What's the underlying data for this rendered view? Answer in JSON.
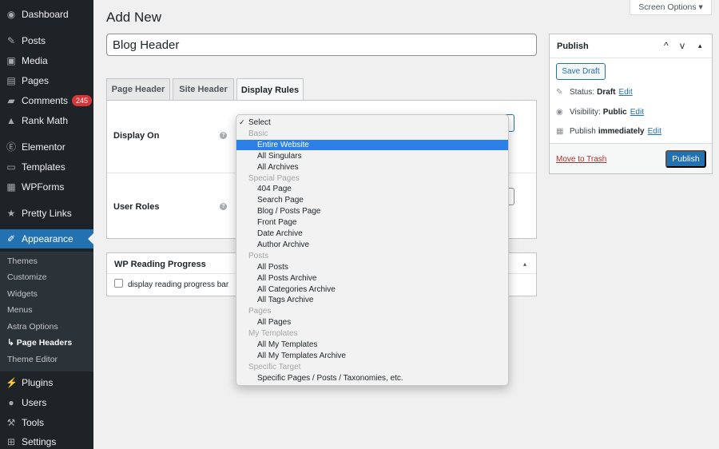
{
  "sidebar": {
    "items": [
      {
        "label": "Dashboard",
        "icon": "dashboard-icon",
        "glyph": "◉"
      },
      {
        "label": "Posts",
        "icon": "pin-icon",
        "glyph": "✎"
      },
      {
        "label": "Media",
        "icon": "media-icon",
        "glyph": "▣"
      },
      {
        "label": "Pages",
        "icon": "pages-icon",
        "glyph": "▤"
      },
      {
        "label": "Comments",
        "icon": "comments-icon",
        "glyph": "▰",
        "badge": "245"
      },
      {
        "label": "Rank Math",
        "icon": "rank-math-icon",
        "glyph": "▲"
      },
      {
        "label": "Elementor",
        "icon": "elementor-icon",
        "glyph": "Ⓔ"
      },
      {
        "label": "Templates",
        "icon": "folder-icon",
        "glyph": "▭"
      },
      {
        "label": "WPForms",
        "icon": "wpforms-icon",
        "glyph": "▦"
      },
      {
        "label": "Pretty Links",
        "icon": "star-icon",
        "glyph": "★"
      },
      {
        "label": "Appearance",
        "icon": "brush-icon",
        "glyph": "✐"
      },
      {
        "label": "Plugins",
        "icon": "plugin-icon",
        "glyph": "⚡"
      },
      {
        "label": "Users",
        "icon": "user-icon",
        "glyph": "●"
      },
      {
        "label": "Tools",
        "icon": "wrench-icon",
        "glyph": "⚒"
      },
      {
        "label": "Settings",
        "icon": "settings-icon",
        "glyph": "⊞"
      }
    ],
    "submenu": [
      "Themes",
      "Customize",
      "Widgets",
      "Menus",
      "Astra Options",
      "↳ Page Headers",
      "Theme Editor"
    ]
  },
  "header": {
    "screen_options": "Screen Options ▾",
    "title": "Add New",
    "title_value": "Blog Header"
  },
  "tabs": [
    "Page Header",
    "Site Header",
    "Display Rules"
  ],
  "rules": {
    "display_on_label": "Display On",
    "user_roles_label": "User Roles",
    "help": "?"
  },
  "reading": {
    "title": "WP Reading Progress",
    "checkbox_label": "display reading progress bar",
    "toggle": "▴"
  },
  "publish": {
    "title": "Publish",
    "save_draft": "Save Draft",
    "status_label": "Status:",
    "status_value": "Draft",
    "visibility_label": "Visibility:",
    "visibility_value": "Public",
    "publish_label": "Publish",
    "publish_value": "immediately",
    "edit": "Edit",
    "trash": "Move to Trash",
    "publish_button": "Publish",
    "ctrl_up": "^",
    "ctrl_down": "v",
    "ctrl_toggle": "▴"
  },
  "dropdown": {
    "items": [
      {
        "text": "Select",
        "kind": "first",
        "checked": true
      },
      {
        "text": "Basic",
        "kind": "group"
      },
      {
        "text": "Entire Website",
        "kind": "opt",
        "selected": true
      },
      {
        "text": "All Singulars",
        "kind": "opt"
      },
      {
        "text": "All Archives",
        "kind": "opt"
      },
      {
        "text": "Special Pages",
        "kind": "group"
      },
      {
        "text": "404 Page",
        "kind": "opt"
      },
      {
        "text": "Search Page",
        "kind": "opt"
      },
      {
        "text": "Blog / Posts Page",
        "kind": "opt"
      },
      {
        "text": "Front Page",
        "kind": "opt"
      },
      {
        "text": "Date Archive",
        "kind": "opt"
      },
      {
        "text": "Author Archive",
        "kind": "opt"
      },
      {
        "text": "Posts",
        "kind": "group"
      },
      {
        "text": "All Posts",
        "kind": "opt"
      },
      {
        "text": "All Posts Archive",
        "kind": "opt"
      },
      {
        "text": "All Categories Archive",
        "kind": "opt"
      },
      {
        "text": "All Tags Archive",
        "kind": "opt"
      },
      {
        "text": "Pages",
        "kind": "group"
      },
      {
        "text": "All Pages",
        "kind": "opt"
      },
      {
        "text": "My Templates",
        "kind": "group"
      },
      {
        "text": "All My Templates",
        "kind": "opt"
      },
      {
        "text": "All My Templates Archive",
        "kind": "opt"
      },
      {
        "text": "Specific Target",
        "kind": "group"
      },
      {
        "text": "Specific Pages / Posts / Taxonomies, etc.",
        "kind": "opt"
      }
    ]
  }
}
